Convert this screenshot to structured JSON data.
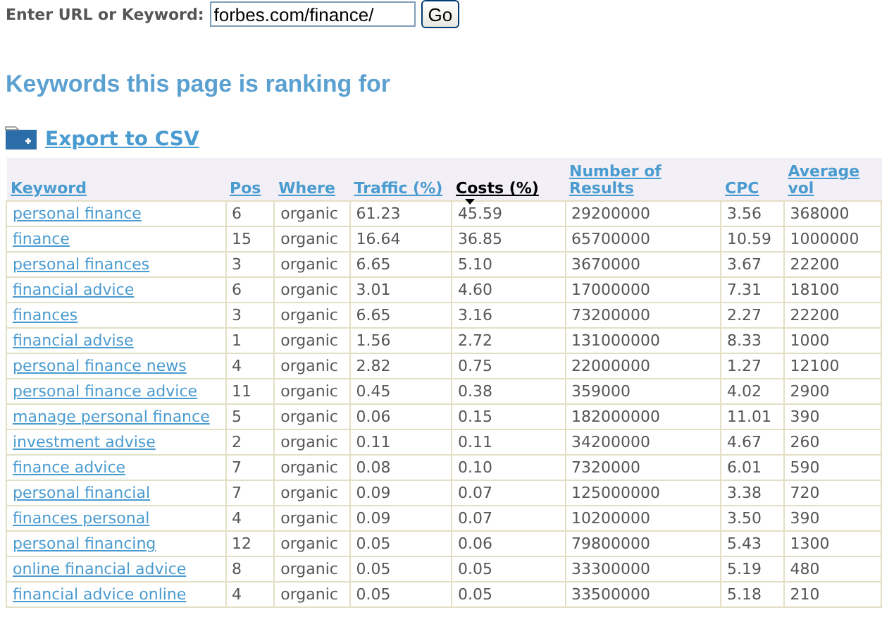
{
  "search": {
    "label": "Enter URL or Keyword:",
    "value": "forbes.com/finance/",
    "button": "Go"
  },
  "heading": "Keywords this page is ranking for",
  "export_link": "Export to CSV",
  "table": {
    "columns": [
      {
        "label": "Keyword",
        "selected": false
      },
      {
        "label": "Pos",
        "selected": false
      },
      {
        "label": "Where",
        "selected": false
      },
      {
        "label": "Traffic (%)",
        "selected": false
      },
      {
        "label": "Costs (%)",
        "selected": true
      },
      {
        "label": "Number of Results",
        "selected": false
      },
      {
        "label": "CPC",
        "selected": false
      },
      {
        "label": "Average vol",
        "selected": false
      }
    ],
    "rows": [
      [
        "personal finance",
        "6",
        "organic",
        "61.23",
        "45.59",
        "29200000",
        "3.56",
        "368000"
      ],
      [
        "finance",
        "15",
        "organic",
        "16.64",
        "36.85",
        "65700000",
        "10.59",
        "1000000"
      ],
      [
        "personal finances",
        "3",
        "organic",
        "6.65",
        "5.10",
        "3670000",
        "3.67",
        "22200"
      ],
      [
        "financial advice",
        "6",
        "organic",
        "3.01",
        "4.60",
        "17000000",
        "7.31",
        "18100"
      ],
      [
        "finances",
        "3",
        "organic",
        "6.65",
        "3.16",
        "73200000",
        "2.27",
        "22200"
      ],
      [
        "financial advise",
        "1",
        "organic",
        "1.56",
        "2.72",
        "131000000",
        "8.33",
        "1000"
      ],
      [
        "personal finance news",
        "4",
        "organic",
        "2.82",
        "0.75",
        "22000000",
        "1.27",
        "12100"
      ],
      [
        "personal finance advice",
        "11",
        "organic",
        "0.45",
        "0.38",
        "359000",
        "4.02",
        "2900"
      ],
      [
        "manage personal finance",
        "5",
        "organic",
        "0.06",
        "0.15",
        "182000000",
        "11.01",
        "390"
      ],
      [
        "investment advise",
        "2",
        "organic",
        "0.11",
        "0.11",
        "34200000",
        "4.67",
        "260"
      ],
      [
        "finance advice",
        "7",
        "organic",
        "0.08",
        "0.10",
        "7320000",
        "6.01",
        "590"
      ],
      [
        "personal financial",
        "7",
        "organic",
        "0.09",
        "0.07",
        "125000000",
        "3.38",
        "720"
      ],
      [
        "finances personal",
        "4",
        "organic",
        "0.09",
        "0.07",
        "10200000",
        "3.50",
        "390"
      ],
      [
        "personal financing",
        "12",
        "organic",
        "0.05",
        "0.06",
        "79800000",
        "5.43",
        "1300"
      ],
      [
        "online financial advice",
        "8",
        "organic",
        "0.05",
        "0.05",
        "33300000",
        "5.19",
        "480"
      ],
      [
        "financial advice online",
        "4",
        "organic",
        "0.05",
        "0.05",
        "33500000",
        "5.18",
        "210"
      ]
    ]
  }
}
